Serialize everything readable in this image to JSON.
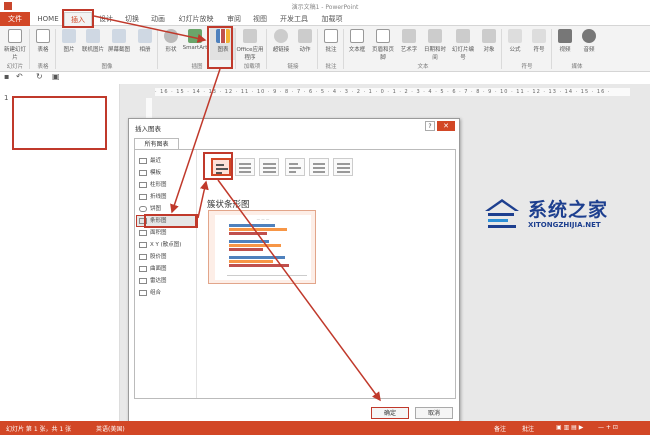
{
  "app": {
    "title": "演示文稿1 - PowerPoint"
  },
  "tabs": [
    "文件",
    "HOME",
    "插入",
    "设计",
    "切换",
    "动画",
    "幻灯片放映",
    "审阅",
    "视图",
    "开发工具",
    "加载项"
  ],
  "ribbon": {
    "buttons": [
      "新建幻灯片",
      "表格",
      "图片",
      "联机图片",
      "屏幕截图",
      "相册",
      "形状",
      "SmartArt",
      "图表",
      "Office应用程序",
      "超链接",
      "动作",
      "批注",
      "文本框",
      "页眉和页脚",
      "艺术字",
      "日期和时间",
      "幻灯片编号",
      "对象",
      "公式",
      "符号",
      "视频",
      "音频"
    ],
    "groups": [
      "幻灯片",
      "表格",
      "图像",
      "插图",
      "加载项",
      "链接",
      "批注",
      "文本",
      "符号",
      "媒体"
    ]
  },
  "ruler": {
    "ticks": "· 16 · 15 · 14 · 13 · 12 · 11 · 10 · 9 · 8 · 7 · 6 · 5 · 4 · 3 · 2 · 1 · 0 · 1 · 2 · 3 · 4 · 5 · 6 · 7 · 8 · 9 · 10 · 11 · 12 · 13 · 14 · 15 · 16 ·"
  },
  "slides": {
    "current_number": "1"
  },
  "dialog": {
    "title": "插入图表",
    "help_glyph": "?",
    "close_glyph": "✕",
    "tab_label": "所有图表",
    "chart_types": [
      "最近",
      "模板",
      "柱形图",
      "折线图",
      "饼图",
      "条形图",
      "面积图",
      "X Y (散点图)",
      "股价图",
      "曲面图",
      "雷达图",
      "组合"
    ],
    "selected_type": "条形图",
    "subtype_title": "簇状条形图",
    "ok_label": "确定",
    "cancel_label": "取消"
  },
  "preview_chart": {
    "bar_colors": [
      "#4f81bd",
      "#c0504d",
      "#9bbb59",
      "#f79646"
    ]
  },
  "statusbar": {
    "slide_info": "幻灯片 第 1 张，共 1 张",
    "language": "英语(美国)",
    "notes_label": "备注",
    "comments_label": "批注"
  },
  "watermark": {
    "cn": "系统之家",
    "en": "XITONGZHIJIA.NET"
  },
  "colors": {
    "accent": "#d24726",
    "highlight": "#c0392b",
    "logo": "#1d3f8f"
  }
}
